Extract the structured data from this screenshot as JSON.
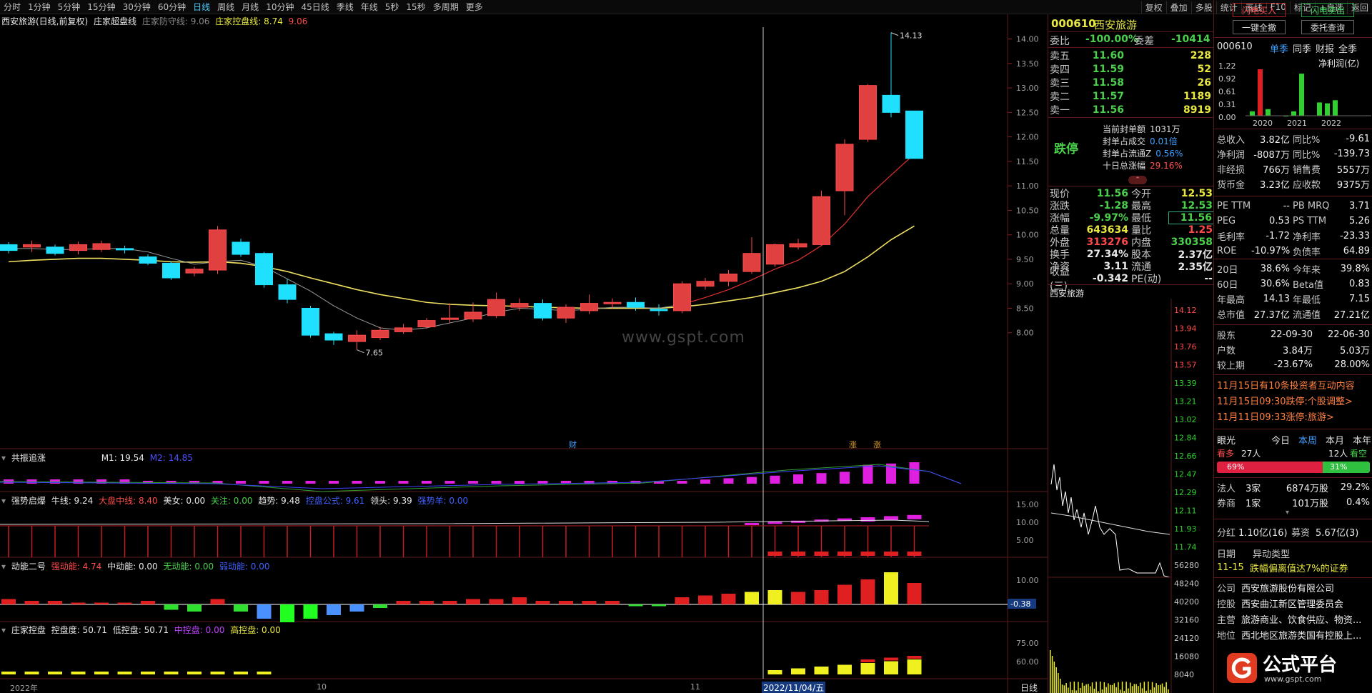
{
  "toolbar": {
    "periods": [
      "分时",
      "1分钟",
      "5分钟",
      "15分钟",
      "30分钟",
      "60分钟",
      "日线",
      "周线",
      "月线",
      "10分钟",
      "45日线",
      "季线",
      "年线",
      "5秒",
      "15秒",
      "多周期",
      "更多"
    ],
    "active_period": "日线",
    "right_items": [
      "复权",
      "叠加",
      "多股",
      "统计",
      "画线",
      "F10",
      "标记",
      "+自选",
      "返回"
    ]
  },
  "main_chart": {
    "title": "西安旅游(日线,前复权)",
    "indicator_name": "庄家超盘线",
    "line1_label": "庄家防守线: 9.06",
    "line2_label": "庄家控盘线: 8.74",
    "line2_value_red": "9.06",
    "y_ticks": [
      "14.00",
      "13.50",
      "13.00",
      "12.50",
      "12.00",
      "11.50",
      "11.00",
      "10.50",
      "10.00",
      "9.50",
      "9.00",
      "8.50",
      "8.00"
    ],
    "high_mark": "14.13",
    "low_mark": "7.65",
    "watermark": "www.gspt.com",
    "marker_cai": "财",
    "marker_zhang": "涨",
    "marker_zhang2": "涨"
  },
  "chart_data": {
    "type": "candlestick",
    "ylim": [
      7.5,
      14.3
    ],
    "candles": [
      [
        9.8,
        9.68,
        9.85,
        9.62
      ],
      [
        9.75,
        9.8,
        9.88,
        9.65
      ],
      [
        9.75,
        9.62,
        9.8,
        9.58
      ],
      [
        9.68,
        9.8,
        9.86,
        9.6
      ],
      [
        9.7,
        9.82,
        9.88,
        9.65
      ],
      [
        9.72,
        9.7,
        9.78,
        9.62
      ],
      [
        9.55,
        9.42,
        9.6,
        9.38
      ],
      [
        9.42,
        9.12,
        9.46,
        9.08
      ],
      [
        9.22,
        9.3,
        9.35,
        9.15
      ],
      [
        9.28,
        10.1,
        10.18,
        9.2
      ],
      [
        9.85,
        9.6,
        9.92,
        9.55
      ],
      [
        9.62,
        8.98,
        9.65,
        8.92
      ],
      [
        8.98,
        8.68,
        9.1,
        8.6
      ],
      [
        8.5,
        7.95,
        8.55,
        7.9
      ],
      [
        7.98,
        7.85,
        8.02,
        7.75
      ],
      [
        7.82,
        7.95,
        8.05,
        7.65
      ],
      [
        7.9,
        8.05,
        8.12,
        7.85
      ],
      [
        8.02,
        8.1,
        8.18,
        7.98
      ],
      [
        8.12,
        8.25,
        8.3,
        8.08
      ],
      [
        8.28,
        8.3,
        8.6,
        8.2
      ],
      [
        8.28,
        8.42,
        8.62,
        8.22
      ],
      [
        8.35,
        8.68,
        8.82,
        8.3
      ],
      [
        8.52,
        8.6,
        8.7,
        8.45
      ],
      [
        8.6,
        8.3,
        8.68,
        8.25
      ],
      [
        8.3,
        8.52,
        8.58,
        8.2
      ],
      [
        8.45,
        8.6,
        8.78,
        8.38
      ],
      [
        8.6,
        8.62,
        8.7,
        8.5
      ],
      [
        8.62,
        8.52,
        8.72,
        8.45
      ],
      [
        8.48,
        8.45,
        8.58,
        8.35
      ],
      [
        8.45,
        9.0,
        9.05,
        8.4
      ],
      [
        8.95,
        9.05,
        9.12,
        8.88
      ],
      [
        9.05,
        9.2,
        9.28,
        8.95
      ],
      [
        9.25,
        9.62,
        9.95,
        9.2
      ],
      [
        9.4,
        9.8,
        9.82,
        9.35
      ],
      [
        9.75,
        9.82,
        9.92,
        9.7
      ],
      [
        9.8,
        10.78,
        10.9,
        9.78
      ],
      [
        10.9,
        11.85,
        11.95,
        10.4
      ],
      [
        11.95,
        13.05,
        13.08,
        11.9
      ],
      [
        12.85,
        12.5,
        14.13,
        12.4
      ],
      [
        12.53,
        11.56,
        12.53,
        11.56
      ]
    ],
    "ma_yellow": [
      9.45,
      9.48,
      9.5,
      9.52,
      9.52,
      9.5,
      9.48,
      9.45,
      9.44,
      9.45,
      9.42,
      9.35,
      9.25,
      9.12,
      9.0,
      8.88,
      8.78,
      8.7,
      8.62,
      8.58,
      8.56,
      8.55,
      8.54,
      8.52,
      8.51,
      8.5,
      8.5,
      8.5,
      8.5,
      8.53,
      8.58,
      8.65,
      8.72,
      8.82,
      8.92,
      9.05,
      9.25,
      9.55,
      9.9,
      10.18
    ],
    "ma_red": [
      9.72,
      9.72,
      9.7,
      9.7,
      9.72,
      9.72,
      9.65,
      9.52,
      9.4,
      9.45,
      9.48,
      9.35,
      9.1,
      8.85,
      8.55,
      8.3,
      8.1,
      8.05,
      8.1,
      8.2,
      8.3,
      8.42,
      8.5,
      8.48,
      8.45,
      8.48,
      8.52,
      8.52,
      8.5,
      8.58,
      8.72,
      8.88,
      9.08,
      9.3,
      9.48,
      9.78,
      10.22,
      10.78,
      11.22,
      11.65
    ]
  },
  "sub1": {
    "name": "共振追涨",
    "m1": "M1: 19.54",
    "m2": "M2: 14.85"
  },
  "sub2": {
    "name": "强势启爆",
    "niu": "牛线: 9.24",
    "dapan": "大盘中线: 8.40",
    "meinv": "美女: 0.00",
    "guanzhu": "关注: 0.00",
    "qushi": "趋势: 9.48",
    "yinfa": "控盘公式: 9.61",
    "lingtou": "领头: 9.39",
    "qiangshi": "强势羊: 0.00",
    "y_ticks": [
      "15.00",
      "10.00",
      "5.00"
    ]
  },
  "sub3": {
    "name": "动能二号",
    "qiang": "强动能: 4.74",
    "zhong": "中动能: 0.00",
    "wu": "无动能: 0.00",
    "ruo": "弱动能: 0.00",
    "y_ticks": [
      "10.00"
    ],
    "neg_value": "-0.38"
  },
  "sub4": {
    "name": "庄家控盘",
    "kongpandu": "控盘度: 50.71",
    "di": "低控盘: 50.71",
    "zhong": "中控盘: 0.00",
    "gao": "高控盘: 0.00",
    "y_ticks": [
      "75.00",
      "60.00"
    ]
  },
  "x_axis": {
    "labels": [
      "2022年",
      "10",
      "11"
    ],
    "date_highlight": "2022/11/04/五",
    "period_label": "日线"
  },
  "quote": {
    "code": "000610",
    "name": "西安旅游",
    "weibi_label": "委比",
    "weibi_val": "-100.00%",
    "weicha_label": "委差",
    "weicha_val": "-10414",
    "asks": [
      {
        "label": "卖五",
        "price": "11.60",
        "vol": "228"
      },
      {
        "label": "卖四",
        "price": "11.59",
        "vol": "52"
      },
      {
        "label": "卖三",
        "price": "11.58",
        "vol": "26"
      },
      {
        "label": "卖二",
        "price": "11.57",
        "vol": "1189"
      },
      {
        "label": "卖一",
        "price": "11.56",
        "vol": "8919"
      }
    ],
    "status": "跌停",
    "seal": [
      {
        "label": "当前封单额",
        "val": "1031万"
      },
      {
        "label": "封单占成交",
        "val": "0.01倍"
      },
      {
        "label": "封单占流通Z",
        "val": "0.56%"
      },
      {
        "label": "十日总涨幅",
        "val": "29.16%"
      }
    ],
    "stats": [
      {
        "l1": "现价",
        "v1": "11.56",
        "l2": "今开",
        "v2": "12.53"
      },
      {
        "l1": "涨跌",
        "v1": "-1.28",
        "l2": "最高",
        "v2": "12.53"
      },
      {
        "l1": "涨幅",
        "v1": "-9.97%",
        "l2": "最低",
        "v2": "11.56"
      },
      {
        "l1": "总量",
        "v1": "643634",
        "l2": "量比",
        "v2": "1.25"
      },
      {
        "l1": "外盘",
        "v1": "313276",
        "l2": "内盘",
        "v2": "330358"
      },
      {
        "l1": "换手",
        "v1": "27.34%",
        "l2": "股本",
        "v2": "2.37亿"
      },
      {
        "l1": "净资",
        "v1": "3.11",
        "l2": "流通",
        "v2": "2.35亿"
      },
      {
        "l1": "收益(三)",
        "v1": "-0.342",
        "l2": "PE(动)",
        "v2": "--"
      }
    ],
    "mini_title": "西安旅游",
    "mini_ticks": [
      "14.12",
      "13.94",
      "13.76",
      "13.57",
      "13.39",
      "13.21",
      "13.02",
      "12.84",
      "12.66",
      "12.47",
      "12.29",
      "12.11",
      "11.93",
      "11.74",
      "56280",
      "48240",
      "40200",
      "32160",
      "24120",
      "16080",
      "8040"
    ]
  },
  "info": {
    "flash_buy": "闪电买入",
    "flash_sell": "闪电卖出",
    "cancel_all": "一键全撤",
    "query": "委托查询",
    "code": "000610",
    "tabs": [
      "单季",
      "同季",
      "财报",
      "全季"
    ],
    "profit_label": "净利润(亿)",
    "bar_ticks": [
      "1.22",
      "0.92",
      "0.61",
      "0.31",
      "0.00"
    ],
    "years": [
      "2020",
      "2021",
      "2022"
    ],
    "fin": [
      {
        "l1": "总收入",
        "v1": "3.82亿",
        "l2": "同比%",
        "v2": "-9.61"
      },
      {
        "l1": "净利润",
        "v1": "-8087万",
        "l2": "同比%",
        "v2": "-139.73"
      },
      {
        "l1": "非经损",
        "v1": "766万",
        "l2": "销售费",
        "v2": "5557万"
      },
      {
        "l1": "货币金",
        "v1": "3.23亿",
        "l2": "应收款",
        "v2": "9375万"
      }
    ],
    "ratios": [
      {
        "l1": "PE TTM",
        "v1": "--",
        "l2": "PB MRQ",
        "v2": "3.71"
      },
      {
        "l1": "PEG",
        "v1": "0.53",
        "l2": "PS TTM",
        "v2": "5.26"
      },
      {
        "l1": "毛利率",
        "v1": "-1.72",
        "l2": "净利率",
        "v2": "-23.33"
      },
      {
        "l1": "ROE",
        "v1": "-10.97%",
        "l2": "负债率",
        "v2": "64.89"
      }
    ],
    "perf": [
      {
        "l1": "20日",
        "v1": "38.6%",
        "l2": "今年来",
        "v2": "39.8%"
      },
      {
        "l1": "60日",
        "v1": "30.6%",
        "l2": "Beta值",
        "v2": "0.83"
      },
      {
        "l1": "年最高",
        "v1": "14.13",
        "l2": "年最低",
        "v2": "7.15"
      },
      {
        "l1": "总市值",
        "v1": "27.37亿",
        "l2": "流通值",
        "v2": "27.21亿"
      }
    ],
    "holders": [
      {
        "l1": "股东",
        "v1": "22-09-30",
        "v2": "22-06-30"
      },
      {
        "l1": "户数",
        "v1": "3.84万",
        "v2": "5.03万"
      },
      {
        "l1": "较上期",
        "v1": "-23.67%",
        "v2": "28.00%"
      }
    ],
    "news": [
      "11月15日有10条投资者互动内容",
      "11月15日09:30跌停:个股调整>",
      "11月11日09:33涨停:旅游>"
    ],
    "eye_label": "眼光",
    "eye_tabs": [
      "今日",
      "本周",
      "本月",
      "本年"
    ],
    "bull_label": "看多",
    "bull_count": "27人",
    "bear_count": "12人",
    "bear_label": "看空",
    "bull_pct": "69%",
    "bear_pct": "31%",
    "inst": [
      {
        "l1": "法人",
        "v1": "3家",
        "v2": "6874万股",
        "v3": "29.2%"
      },
      {
        "l1": "券商",
        "v1": "1家",
        "v2": "101万股",
        "v3": "0.4%"
      }
    ],
    "dividend": {
      "l": "分红",
      "v1": "1.10亿(16)",
      "l2": "募资",
      "v2": "5.67亿(3)"
    },
    "anomaly": {
      "l1": "日期",
      "l2": "异动类型",
      "date": "11-15",
      "desc": "跌幅偏离值达7%的证券"
    },
    "company": [
      {
        "l": "公司",
        "v": "西安旅游股份有限公司"
      },
      {
        "l": "控股",
        "v": "西安曲江新区管理委员会"
      },
      {
        "l": "主营",
        "v": "旅游商业、饮食供应、物资..."
      },
      {
        "l": "地位",
        "v": "西北地区旅游类国有控股上..."
      }
    ],
    "logo_text": "公式平台",
    "logo_url": "www.gspt.com"
  }
}
